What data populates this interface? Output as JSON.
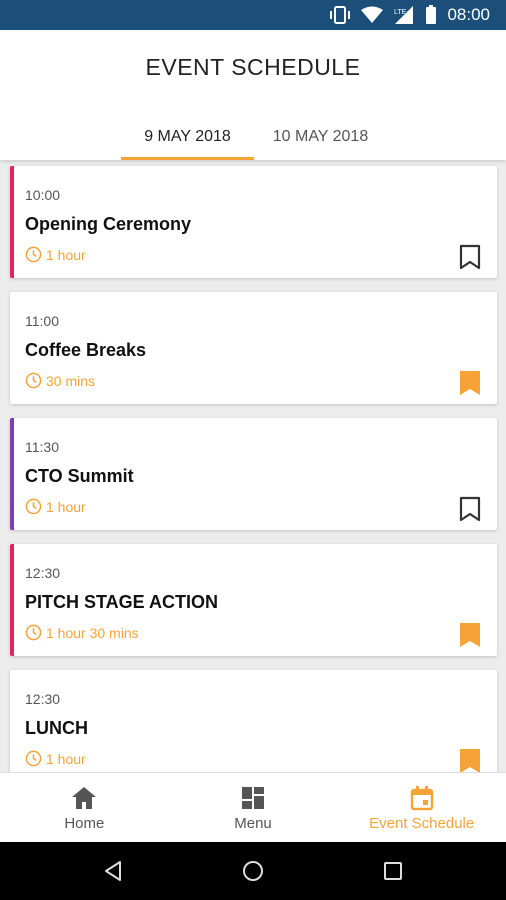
{
  "status_bar": {
    "time": "08:00",
    "network_label": "LTE"
  },
  "header": {
    "title": "EVENT SCHEDULE"
  },
  "tabs": [
    {
      "label": "9 MAY 2018",
      "active": true
    },
    {
      "label": "10 MAY 2018",
      "active": false
    }
  ],
  "events": [
    {
      "time": "10:00",
      "title": "Opening Ceremony",
      "duration": "1 hour",
      "accent": "#e0245e",
      "bookmarked": false
    },
    {
      "time": "11:00",
      "title": "Coffee Breaks",
      "duration": "30 mins",
      "accent": "",
      "bookmarked": true
    },
    {
      "time": "11:30",
      "title": "CTO Summit",
      "duration": "1 hour",
      "accent": "#7b3fb0",
      "bookmarked": false
    },
    {
      "time": "12:30",
      "title": "PITCH STAGE ACTION",
      "duration": "1 hour 30 mins",
      "accent": "#e0245e",
      "bookmarked": true
    },
    {
      "time": "12:30",
      "title": "LUNCH",
      "duration": "1 hour",
      "accent": "",
      "bookmarked": true
    }
  ],
  "bottom_nav": [
    {
      "label": "Home",
      "icon": "home-icon",
      "active": false
    },
    {
      "label": "Menu",
      "icon": "grid-icon",
      "active": false
    },
    {
      "label": "Event Schedule",
      "icon": "calendar-icon",
      "active": true
    }
  ],
  "colors": {
    "status_bar": "#1b4f7a",
    "accent_orange": "#f5a337",
    "accent_pink": "#e0245e",
    "accent_purple": "#7b3fb0"
  }
}
